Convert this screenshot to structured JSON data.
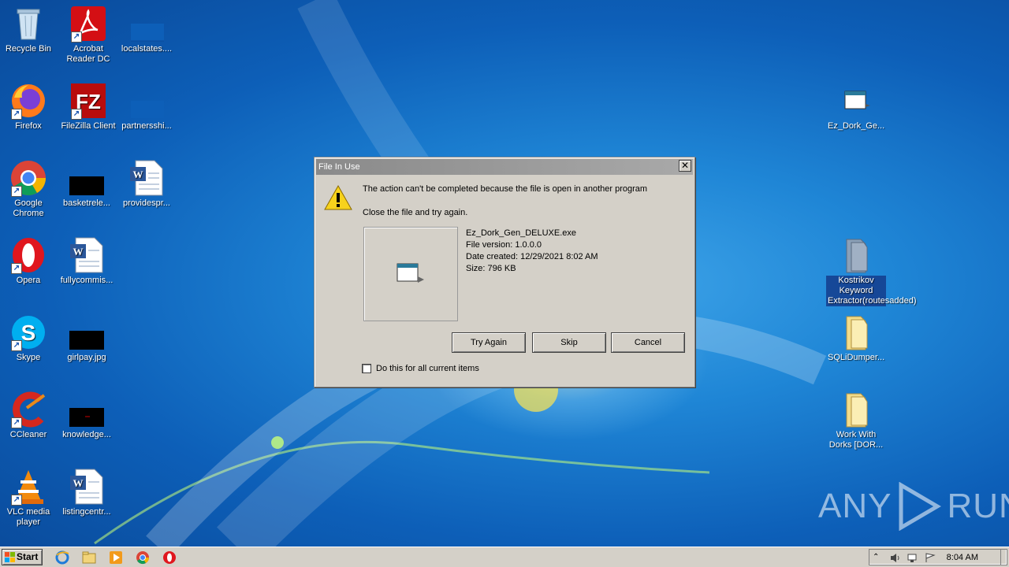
{
  "desktop": {
    "icons": [
      {
        "label": "Recycle Bin"
      },
      {
        "label": "Acrobat Reader DC"
      },
      {
        "label": "localstates...."
      },
      {
        "label": "Firefox"
      },
      {
        "label": "FileZilla Client"
      },
      {
        "label": "partnersshi..."
      },
      {
        "label": "Google Chrome"
      },
      {
        "label": "basketrele..."
      },
      {
        "label": "providespr..."
      },
      {
        "label": "Opera"
      },
      {
        "label": "fullycommis..."
      },
      {
        "label": "Skype"
      },
      {
        "label": "girlpay.jpg"
      },
      {
        "label": "CCleaner"
      },
      {
        "label": "knowledge..."
      },
      {
        "label": "VLC media player"
      },
      {
        "label": "listingcentr..."
      },
      {
        "label": "Ez_Dork_Ge..."
      },
      {
        "label": "Kostrikov Keyword Extractor(routesadded)"
      },
      {
        "label": "SQLiDumper..."
      },
      {
        "label": "Work With Dorks [DOR..."
      }
    ]
  },
  "dialog": {
    "title": "File In Use",
    "close_glyph": "✕",
    "message": "The action can't be completed because the file is open in another program",
    "instruction": "Close the file and try again.",
    "file": {
      "name": "Ez_Dork_Gen_DELUXE.exe",
      "version": "File version: 1.0.0.0",
      "created": "Date created: 12/29/2021 8:02 AM",
      "size": "Size: 796 KB"
    },
    "buttons": {
      "try_again": "Try Again",
      "skip": "Skip",
      "cancel": "Cancel"
    },
    "checkbox_label": "Do this for all current items",
    "checkbox_checked": false
  },
  "watermark": {
    "text_left": "ANY",
    "text_right": "RUN"
  },
  "taskbar": {
    "start_label": "Start",
    "clock": "8:04 AM",
    "quick_launch": [
      "ie-icon",
      "explorer-icon",
      "media-player-icon",
      "chrome-icon",
      "opera-icon"
    ]
  },
  "colors": {
    "desktop": "#1f86d6",
    "dialog_face": "#d4d0c8",
    "selection": "#143c8c"
  }
}
